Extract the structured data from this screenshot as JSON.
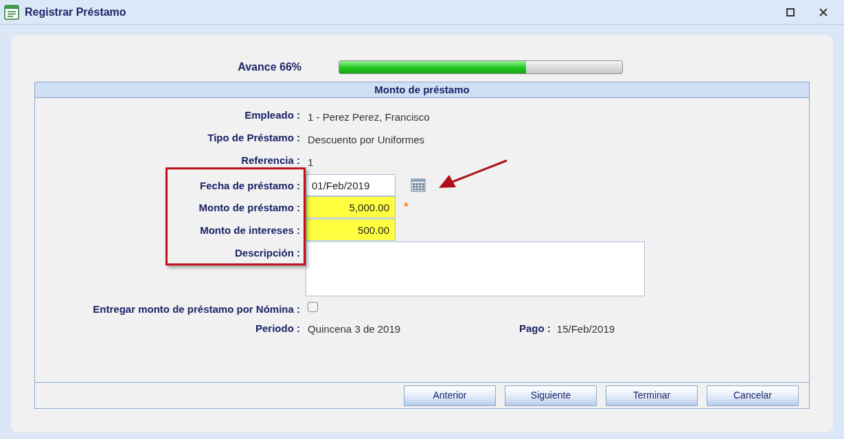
{
  "window": {
    "title": "Registrar Préstamo"
  },
  "progress": {
    "label": "Avance 66%",
    "level": 0.66
  },
  "section": {
    "title": "Monto de préstamo"
  },
  "fields": [
    {
      "kind": "text",
      "label": "Empleado :",
      "value": "1 - Perez Perez, Francisco"
    },
    {
      "kind": "text",
      "label": "Tipo de Préstamo :",
      "value": "Descuento por Uniformes"
    },
    {
      "kind": "text",
      "label": "Referencia :",
      "value": "1"
    },
    {
      "kind": "date",
      "label": "Fecha de préstamo :",
      "value": "01/Feb/2019",
      "highlighted": false
    },
    {
      "kind": "input",
      "label": "Monto de préstamo :",
      "value": "5,000.00",
      "highlighted": true,
      "required": true,
      "required_mark": "*"
    },
    {
      "kind": "input",
      "label": "Monto de intereses :",
      "value": "500.00",
      "highlighted": true
    },
    {
      "kind": "textarea",
      "label": "Descripción :"
    },
    {
      "kind": "checkbox",
      "label": "Entregar monto de préstamo por Nómina :",
      "checked": false
    }
  ],
  "period": {
    "label": "Periodo :",
    "value": "Quincena 3 de 2019",
    "pay_label": "Pago :",
    "pay_value": "15/Feb/2019"
  },
  "buttons": [
    "Anterior",
    "Siguiente",
    "Terminar",
    "Cancelar"
  ]
}
